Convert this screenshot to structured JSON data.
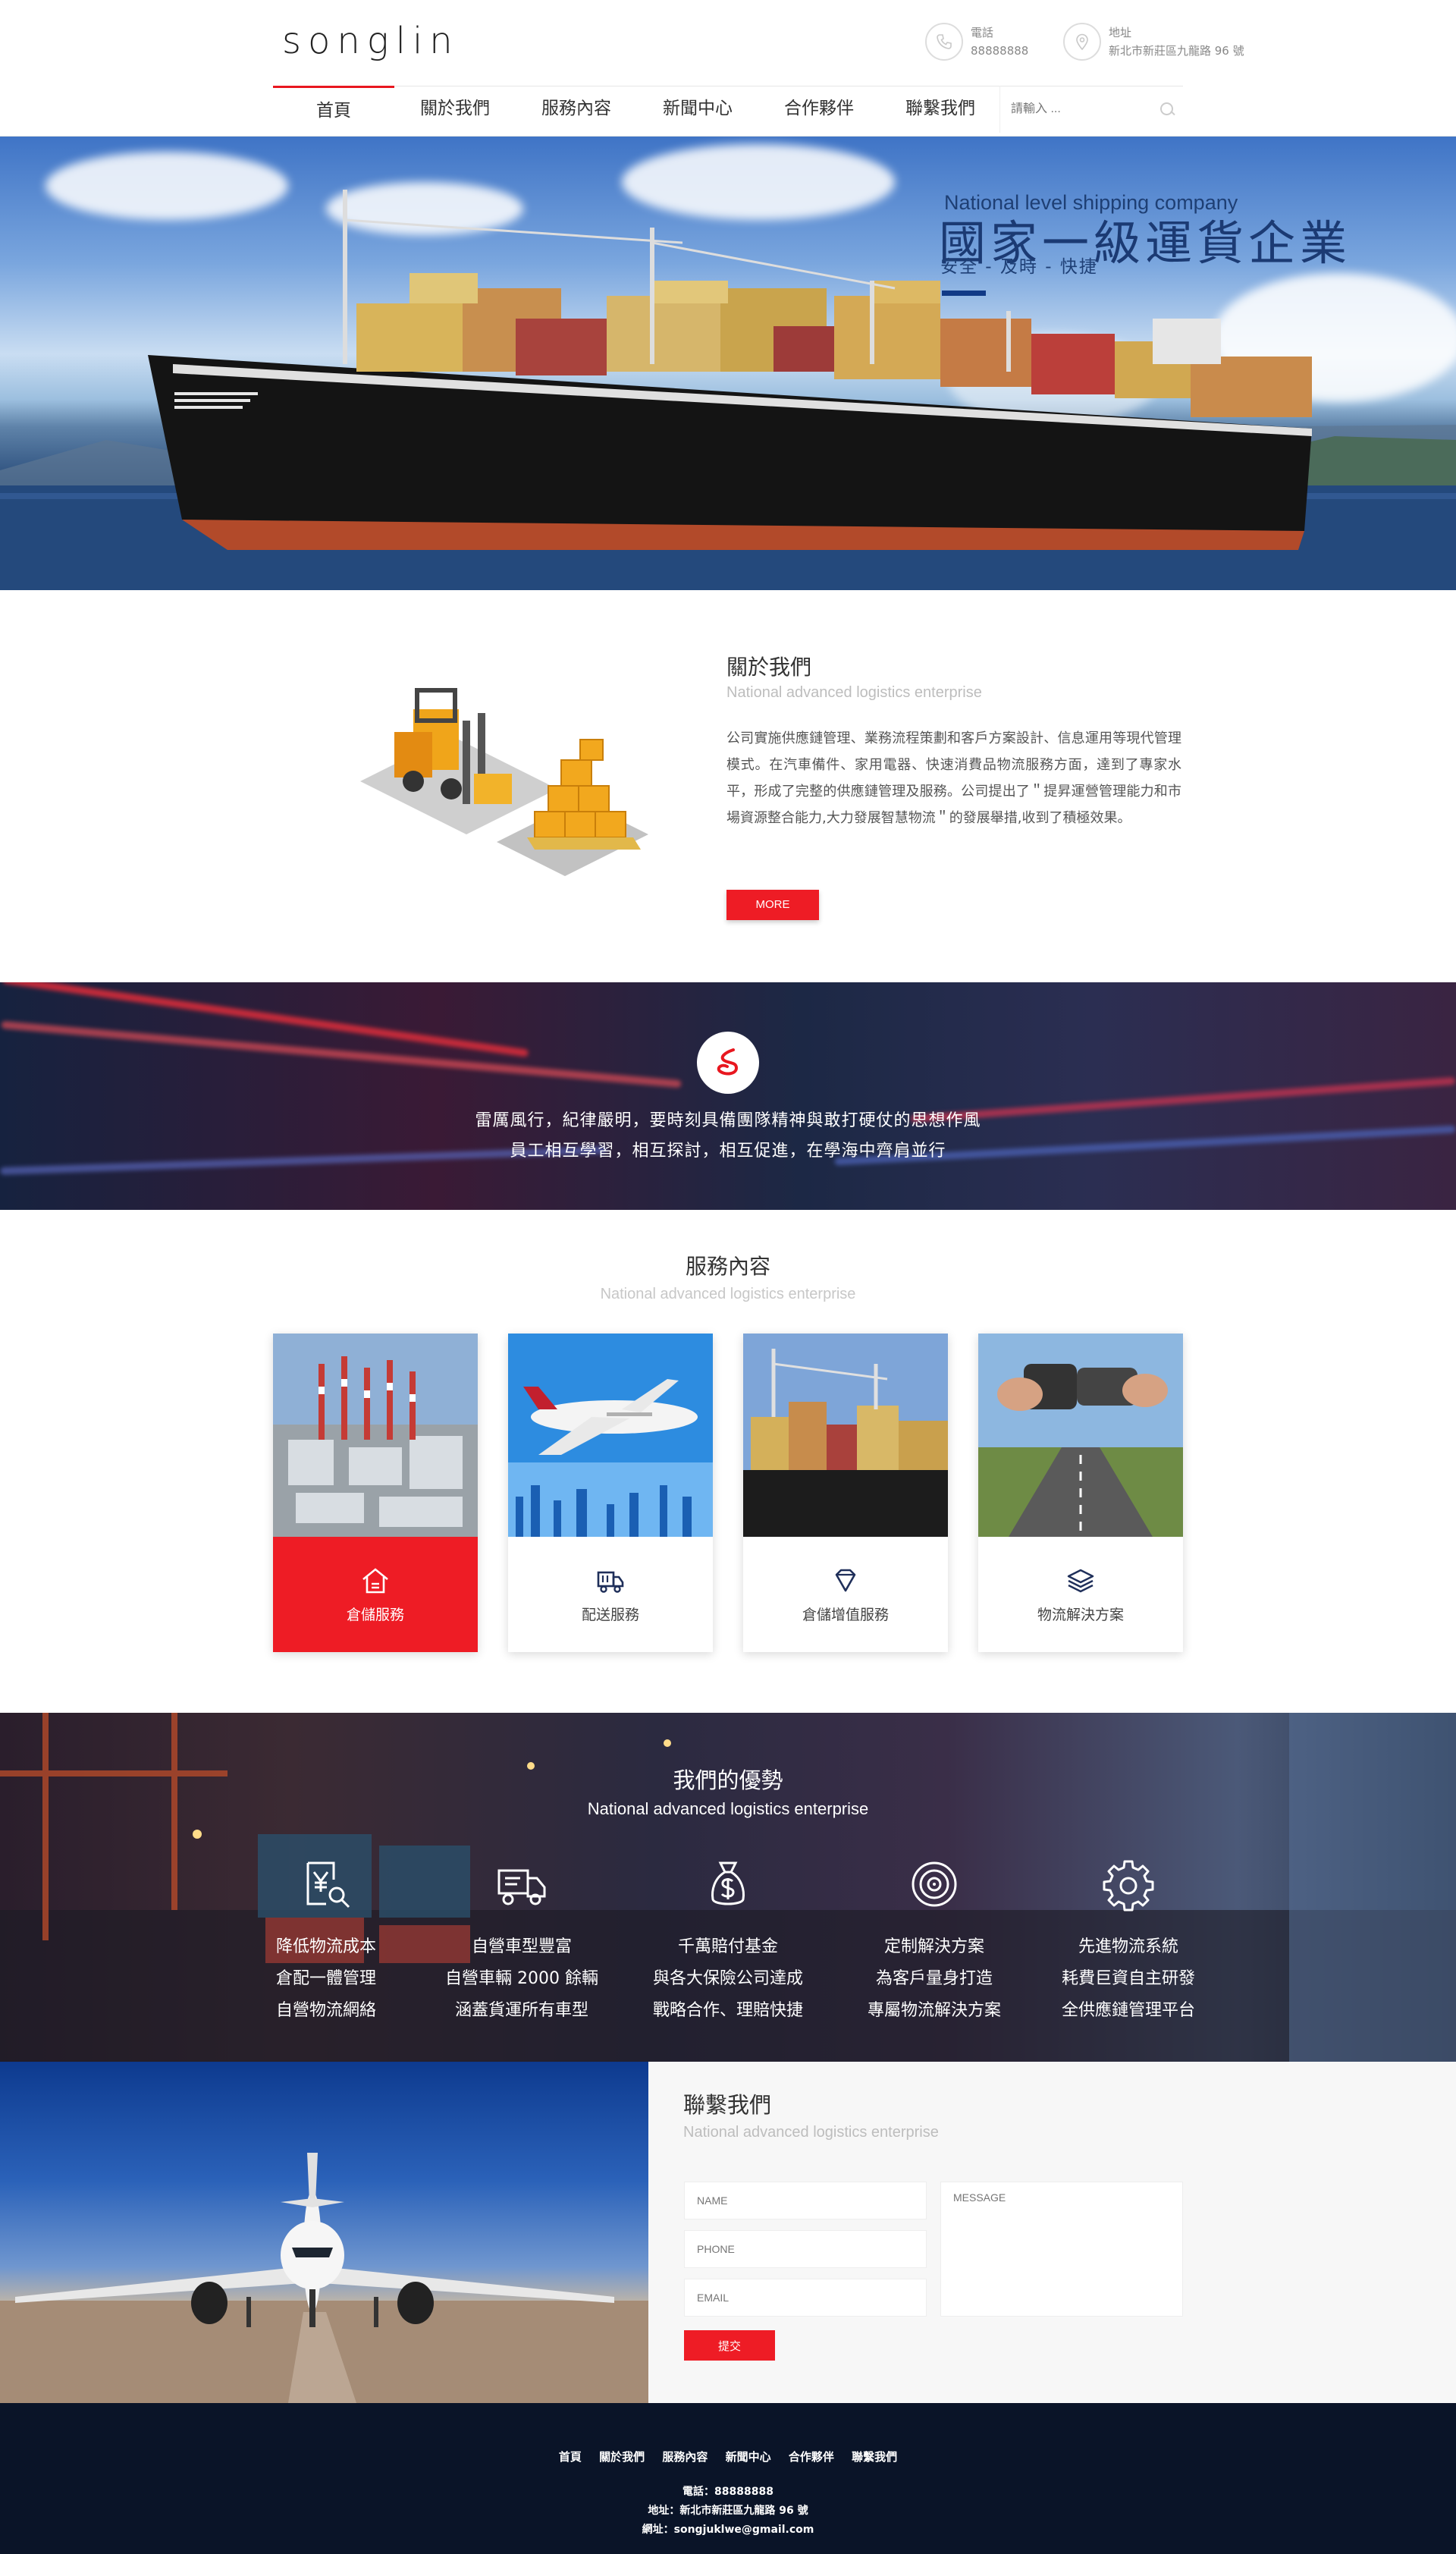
{
  "header": {
    "logo": "songlin",
    "phone_label": "電話",
    "phone": "88888888",
    "address_label": "地址",
    "address": "新北市新莊區九龍路 96 號",
    "search_placeholder": "請輸入 ..."
  },
  "nav": [
    "首頁",
    "關於我們",
    "服務內容",
    "新聞中心",
    "合作夥伴",
    "聯繫我們"
  ],
  "hero": {
    "en": "National level shipping company",
    "title": "國家一級運貨企業",
    "subtitle": "安全 - 及時 - 快捷"
  },
  "about": {
    "title": "關於我們",
    "en": "National advanced logistics enterprise",
    "text": "公司實施供應鏈管理、業務流程策劃和客戶方案設計、信息運用等現代管理模式。在汽車備件、家用電器、快速消費品物流服務方面，達到了專家水平，形成了完整的供應鏈管理及服務。公司提出了＂提昇運營管理能力和市場資源整合能力,大力發展智慧物流＂的發展舉措,收到了積極效果。",
    "more": "MORE"
  },
  "band": {
    "line1": "雷厲風行，紀律嚴明，要時刻具備團隊精神與敢打硬仗的思想作風",
    "line2": "員工相互學習，相互探討，相互促進，在學海中齊肩並行"
  },
  "services": {
    "title": "服務內容",
    "en": "National advanced logistics enterprise",
    "items": [
      {
        "label": "倉儲服務",
        "icon": "warehouse-icon"
      },
      {
        "label": "配送服務",
        "icon": "delivery-truck-icon"
      },
      {
        "label": "倉儲增值服務",
        "icon": "diamond-icon"
      },
      {
        "label": "物流解決方案",
        "icon": "layers-icon"
      }
    ]
  },
  "advantages": {
    "title": "我們的優勢",
    "en": "National advanced logistics enterprise",
    "items": [
      {
        "icon": "yen-document-icon",
        "lines": [
          "降低物流成本",
          "倉配一體管理",
          "自營物流網絡"
        ]
      },
      {
        "icon": "truck-icon",
        "lines": [
          "自營車型豐富",
          "自營車輛 2000 餘輛",
          "涵蓋貨運所有車型"
        ]
      },
      {
        "icon": "money-bag-icon",
        "lines": [
          "千萬賠付基金",
          "與各大保險公司達成",
          "戰略合作、理賠快捷"
        ]
      },
      {
        "icon": "target-icon",
        "lines": [
          "定制解決方案",
          "為客戶量身打造",
          "專屬物流解決方案"
        ]
      },
      {
        "icon": "gear-icon",
        "lines": [
          "先進物流系統",
          "耗費巨資自主研發",
          "全供應鏈管理平台"
        ]
      }
    ]
  },
  "contact": {
    "title": "聯繫我們",
    "en": "National advanced logistics enterprise",
    "name_ph": "NAME",
    "phone_ph": "PHONE",
    "email_ph": "EMAIL",
    "message_ph": "MESSAGE",
    "submit": "提交"
  },
  "footer": {
    "nav": [
      "首頁",
      "關於我們",
      "服務內容",
      "新聞中心",
      "合作夥伴",
      "聯繫我們"
    ],
    "phone": "電話：88888888",
    "address": "地址：新北市新莊區九龍路 96 號",
    "email": "網址：songjuklwe@gmail.com"
  },
  "colors": {
    "accent": "#ee1c25",
    "navy": "#0a1428",
    "hero_text": "#1b3a73"
  }
}
